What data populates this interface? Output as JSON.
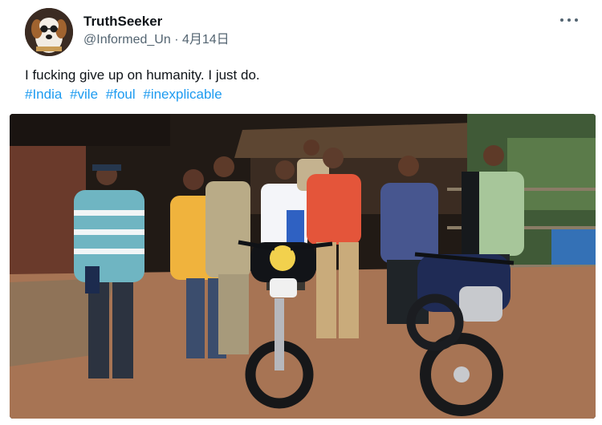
{
  "tweet": {
    "display_name": "TruthSeeker",
    "handle": "@Informed_Un",
    "separator": "·",
    "date": "4月14日",
    "text": "I fucking give up on humanity. I just do.",
    "hashtags": [
      "#India",
      "#vile",
      "#foul",
      "#inexplicable"
    ],
    "avatar_icon": "dog-avatar-icon",
    "more_icon": "more-options-icon",
    "hashtag_color": "#1d9bf0",
    "photo_description_icon": "photo"
  }
}
